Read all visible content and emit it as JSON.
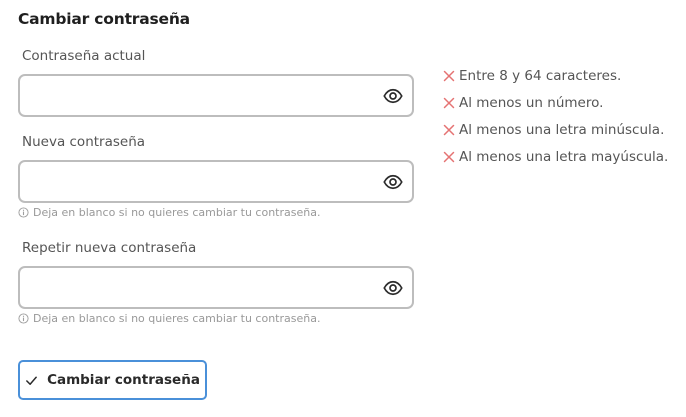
{
  "form": {
    "title": "Cambiar contraseña",
    "fields": [
      {
        "label": "Contraseña actual",
        "value": "",
        "icon": "eye-icon"
      },
      {
        "label": "Nueva contraseña",
        "value": "",
        "icon": "eye-icon",
        "hint": "Deja en blanco si no quieres cambiar tu contraseña."
      },
      {
        "label": "Repetir nueva contraseña",
        "value": "",
        "icon": "eye-icon",
        "hint": "Deja en blanco si no quieres cambiar tu contraseña."
      }
    ],
    "requirements": [
      {
        "text": "Entre 8 y 64 caracteres.",
        "met": false
      },
      {
        "text": "Al menos un número.",
        "met": false
      },
      {
        "text": "Al menos una letra minúscula.",
        "met": false
      },
      {
        "text": "Al menos una letra mayúscula.",
        "met": false
      }
    ],
    "submit_label": "Cambiar contraseña"
  },
  "colors": {
    "requirement_unmet": "#e57373",
    "button_border": "#4a90d9",
    "input_border": "#bdbdbd"
  }
}
